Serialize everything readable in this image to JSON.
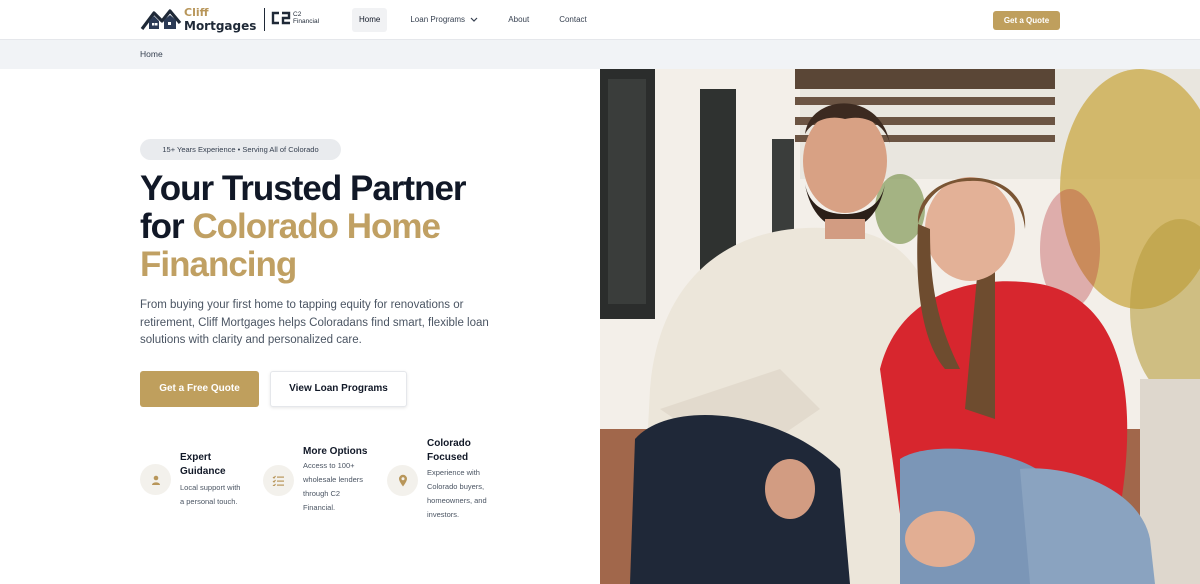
{
  "brand": {
    "name_line1": "Cliff",
    "name_line2": "Mortgages",
    "partner_line1": "C2",
    "partner_line2": "Financial"
  },
  "nav": {
    "items": [
      {
        "label": "Home",
        "active": true
      },
      {
        "label": "Loan Programs",
        "has_dropdown": true
      },
      {
        "label": "About"
      },
      {
        "label": "Contact"
      }
    ],
    "cta_label": "Get a Quote"
  },
  "breadcrumb": {
    "current": "Home"
  },
  "hero": {
    "badge": "15+ Years Experience • Serving All of Colorado",
    "headline_plain_1": "Your Trusted Partner",
    "headline_plain_2": "for",
    "headline_accent_1": "Colorado Home",
    "headline_accent_2": "Financing",
    "subtext": "From buying your first home to tapping equity for renovations or retirement, Cliff Mortgages helps Coloradans find smart, flexible loan solutions with clarity and personalized care.",
    "primary_button": "Get a Free Quote",
    "secondary_button": "View Loan Programs"
  },
  "features": [
    {
      "icon": "person-icon",
      "title_1": "Expert",
      "title_2": "Guidance",
      "desc_1": "Local support with",
      "desc_2": "a personal touch."
    },
    {
      "icon": "checklist-icon",
      "title_1": "More Options",
      "desc_1": "Access to 100+",
      "desc_2": "wholesale lenders",
      "desc_3": "through C2",
      "desc_4": "Financial."
    },
    {
      "icon": "location-pin-icon",
      "title_1": "Colorado",
      "title_2": "Focused",
      "desc_1": "Experience with",
      "desc_2": "Colorado buyers,",
      "desc_3": "homeowners, and",
      "desc_4": "investors."
    }
  ],
  "colors": {
    "accent": "#bf9f5d",
    "headline": "#111827",
    "accent_text": "#c0a063",
    "breadcrumb_bg": "#f1f3f6"
  }
}
